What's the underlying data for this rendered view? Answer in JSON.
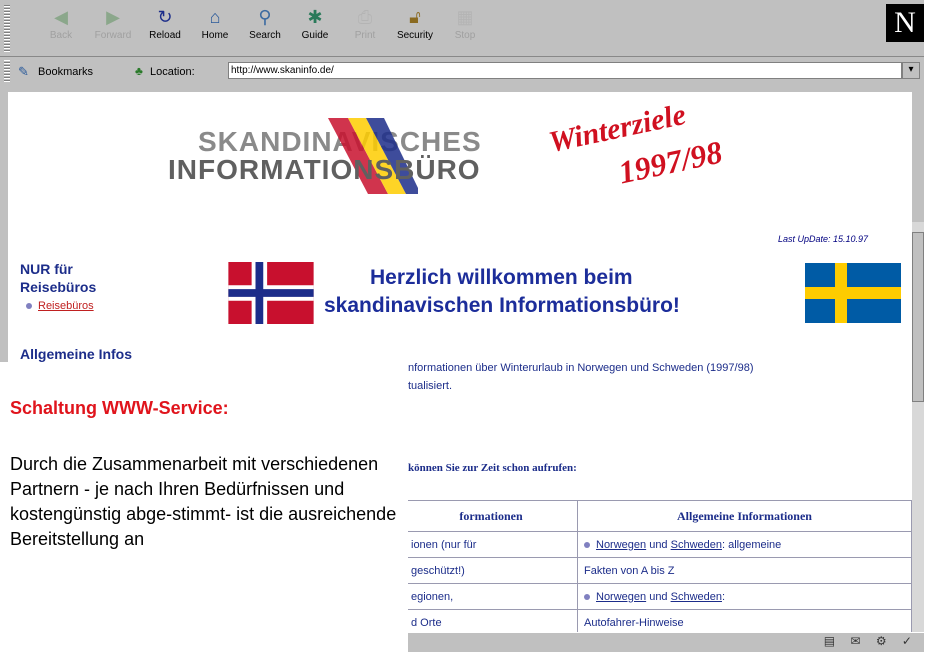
{
  "toolbar": {
    "buttons": [
      {
        "label": "Back",
        "icon": "back-arrow-icon",
        "enabled": false
      },
      {
        "label": "Forward",
        "icon": "forward-arrow-icon",
        "enabled": false
      },
      {
        "label": "Reload",
        "icon": "reload-icon",
        "enabled": true
      },
      {
        "label": "Home",
        "icon": "home-icon",
        "enabled": true
      },
      {
        "label": "Search",
        "icon": "search-icon",
        "enabled": true
      },
      {
        "label": "Guide",
        "icon": "guide-icon",
        "enabled": true
      },
      {
        "label": "Print",
        "icon": "print-icon",
        "enabled": false
      },
      {
        "label": "Security",
        "icon": "lock-icon",
        "enabled": true
      },
      {
        "label": "Stop",
        "icon": "stop-icon",
        "enabled": false
      }
    ],
    "logo": "N"
  },
  "locationbar": {
    "bookmarks_label": "Bookmarks",
    "location_label": "Location:",
    "url": "http://www.skaninfo.de/"
  },
  "page": {
    "logo_line1": "SKANDINAVISCHES",
    "logo_line2": "INFORMATIONSBÜRO",
    "winterziele": "Winterziele",
    "winterziele_year": "1997/98",
    "last_update": "Last UpDate: 15.10.97",
    "nur_fuer": "NUR für Reisebüros",
    "reisebueros_link": "Reisebüros",
    "allgemeine_infos": "Allgemeine Infos",
    "welcome_line1": "Herzlich willkommen beim",
    "welcome_line2": "skandinavischen Informationsbüro!",
    "intro_line1": "nformationen über Winterurlaub in Norwegen und Schweden (1997/98)",
    "intro_line2": "tualisiert.",
    "koennen": "können Sie zur Zeit schon aufrufen:",
    "table": {
      "headers": [
        "formationen",
        "Allgemeine Informationen"
      ],
      "rows": [
        {
          "left": "ionen (nur für",
          "right_link1": "Norwegen",
          "right_mid": " und ",
          "right_link2": "Schweden",
          "right_rest": ": allgemeine"
        },
        {
          "left": "geschützt!)",
          "right_text": "Fakten von A bis Z"
        },
        {
          "left": "egionen,",
          "right_link1": "Norwegen",
          "right_mid": " und ",
          "right_link2": "Schweden",
          "right_rest": ":"
        },
        {
          "left": "d Orte",
          "right_text": "Autofahrer-Hinweise"
        }
      ]
    }
  },
  "overlay": {
    "title": "Schaltung WWW-Service:",
    "text": "Durch die Zusammenarbeit mit verschiedenen Partnern - je nach Ihren Bedürfnissen und kostengünstig abge-stimmt- ist die ausreichende Bereitstellung an"
  },
  "colors": {
    "heading_blue": "#1c2d8a",
    "accent_red": "#e0141c",
    "norway_red": "#c8102e",
    "sweden_blue": "#005ba5",
    "sweden_yellow": "#fecc00"
  }
}
